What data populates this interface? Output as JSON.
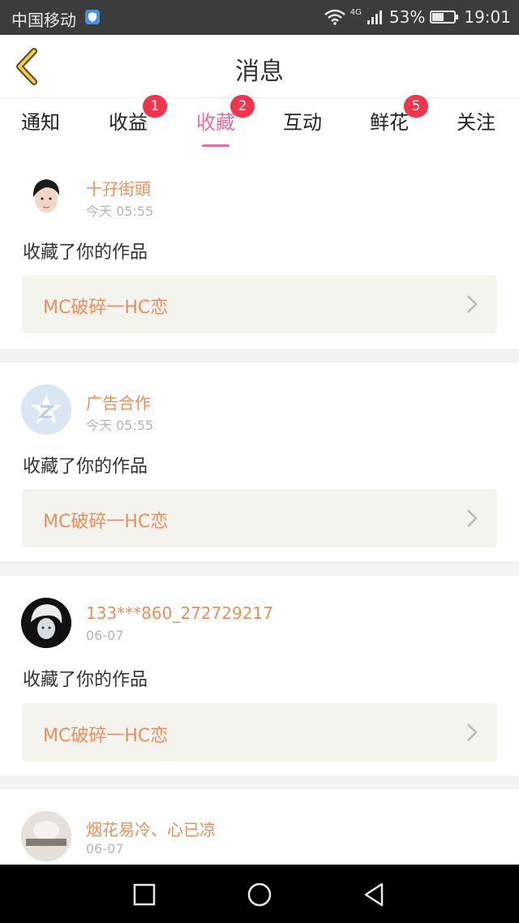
{
  "status_bar": {
    "carrier": "中国移动",
    "network": "4G",
    "battery": "53%",
    "time": "19:01"
  },
  "header": {
    "title": "消息"
  },
  "tabs": [
    {
      "label": "通知",
      "badge": ""
    },
    {
      "label": "收益",
      "badge": "1"
    },
    {
      "label": "收藏",
      "badge": "2",
      "active": true
    },
    {
      "label": "互动",
      "badge": ""
    },
    {
      "label": "鲜花",
      "badge": "5"
    },
    {
      "label": "关注",
      "badge": ""
    }
  ],
  "messages": [
    {
      "user": "十孖街頭",
      "date": "今天 05:55",
      "action": "收藏了你的作品",
      "work": "MC破碎一HC恋"
    },
    {
      "user": "广告合作",
      "date": "今天 05:55",
      "action": "收藏了你的作品",
      "work": "MC破碎一HC恋"
    },
    {
      "user": "133***860_272729217",
      "date": "06-07",
      "action": "收藏了你的作品",
      "work": "MC破碎一HC恋"
    },
    {
      "user": "烟花易冷、心已凉",
      "date": "06-07",
      "action": "",
      "work": ""
    }
  ],
  "colors": {
    "accent_pink": "#e36fa6",
    "badge_red": "#f2354e",
    "name_orange": "#e8905d"
  }
}
